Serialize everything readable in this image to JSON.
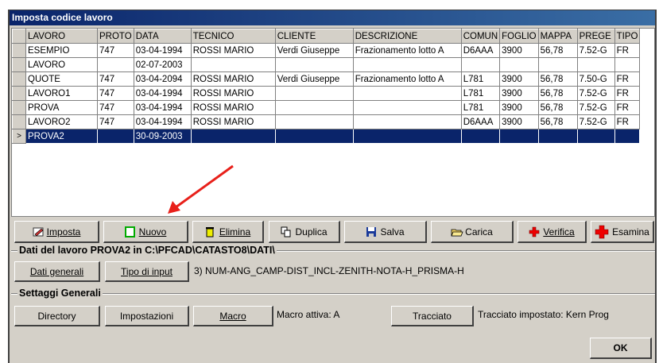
{
  "window": {
    "title": "Imposta codice lavoro"
  },
  "grid": {
    "columns": [
      "LAVORO",
      "PROTO",
      "DATA",
      "TECNICO",
      "CLIENTE",
      "DESCRIZIONE",
      "COMUN",
      "FOGLIO",
      "MAPPA",
      "PREGE",
      "TIPO"
    ],
    "rows": [
      [
        "ESEMPIO",
        "747",
        "03-04-1994",
        "ROSSI MARIO",
        "Verdi Giuseppe",
        "Frazionamento lotto A",
        "D6AAA",
        "3900",
        "56,78",
        "7.52-G",
        "FR"
      ],
      [
        "LAVORO",
        "",
        "02-07-2003",
        "",
        "",
        "",
        "",
        "",
        "",
        "",
        ""
      ],
      [
        "QUOTE",
        "747",
        "03-04-2094",
        "ROSSI MARIO",
        "Verdi Giuseppe",
        "Frazionamento lotto A",
        "L781",
        "3900",
        "56,78",
        "7.50-G",
        "FR"
      ],
      [
        "LAVORO1",
        "747",
        "03-04-1994",
        "ROSSI MARIO",
        "",
        "",
        "L781",
        "3900",
        "56,78",
        "7.52-G",
        "FR"
      ],
      [
        "PROVA",
        "747",
        "03-04-1994",
        "ROSSI MARIO",
        "",
        "",
        "L781",
        "3900",
        "56,78",
        "7.52-G",
        "FR"
      ],
      [
        "LAVORO2",
        "747",
        "03-04-1994",
        "ROSSI MARIO",
        "",
        "",
        "D6AAA",
        "3900",
        "56,78",
        "7.52-G",
        "FR"
      ],
      [
        "PROVA2",
        "",
        "30-09-2003",
        "",
        "",
        "",
        "",
        "",
        "",
        "",
        ""
      ]
    ],
    "selected_indicator": ">"
  },
  "toolbar": {
    "imposta": "Imposta",
    "nuovo": "Nuovo",
    "elimina": "Elimina",
    "duplica": "Duplica",
    "salva": "Salva",
    "carica": "Carica",
    "verifica": "Verifica",
    "esamina": "Esamina"
  },
  "dati_lavoro": {
    "title": "Dati del lavoro PROVA2 in C:\\PFCAD\\CATASTO8\\DATI\\",
    "btn_dati_generali": "Dati generali",
    "btn_tipo_input": "Tipo di input",
    "input_type_text": "3) NUM-ANG_CAMP-DIST_INCL-ZENITH-NOTA-H_PRISMA-H"
  },
  "settaggi": {
    "title": "Settaggi Generali",
    "btn_directory": "Directory",
    "btn_impostazioni": "Impostazioni",
    "btn_macro": "Macro",
    "macro_status": "Macro attiva: A",
    "btn_tracciato": "Tracciato",
    "tracciato_status": "Tracciato impostato: Kern Prog"
  },
  "ok_label": "OK",
  "colors": {
    "title_start": "#0a246a",
    "title_end": "#3a6ea5",
    "selection": "#0a246a",
    "arrow": "#e8201a"
  }
}
